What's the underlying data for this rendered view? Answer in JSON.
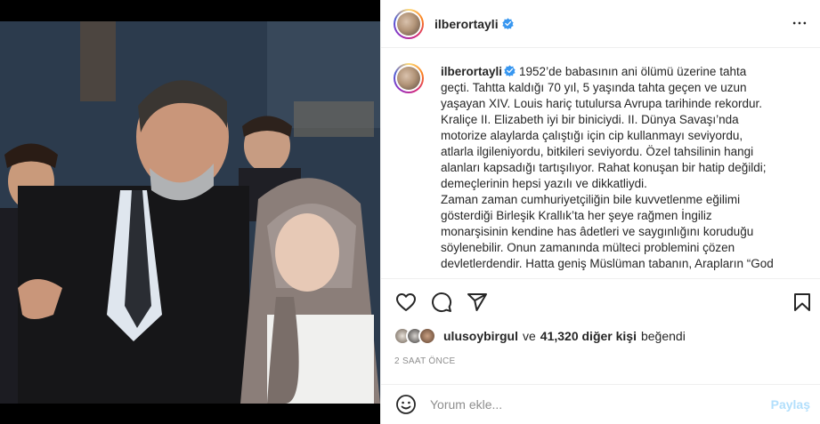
{
  "post": {
    "username": "ilberortayli",
    "caption_lines": [
      "1952’de babasının ani ölümü üzerine tahta",
      "geçti. Tahtta kaldığı 70 yıl, 5 yaşında tahta geçen ve uzun",
      "yaşayan XIV. Louis hariç tutulursa Avrupa tarihinde rekordur.",
      "Kraliçe II. Elizabeth iyi bir biniciydi. II. Dünya Savaşı’nda",
      "motorize alaylarda çalıştığı için cip kullanmayı seviyordu,",
      "atlarla ilgileniyordu, bitkileri seviyordu. Özel tahsilinin hangi",
      "alanları kapsadığı tartışılıyor. Rahat konuşan bir hatip değildi;",
      "demeçlerinin hepsi yazılı ve dikkatliydi.",
      "Zaman zaman cumhuriyetçiliğin bile kuvvetlenme eğilimi",
      "gösterdiği Birleşik Krallık’ta her şeye rağmen İngiliz",
      "monarşisinin kendine has âdetleri ve saygınlığını koruduğu",
      "söylenebilir. Onun zamanında mülteci problemini çözen",
      "devletlerdendir. Hatta geniş Müslüman tabanın, Arapların “God"
    ],
    "liked_by_user": "ulusoybirgul",
    "likes_connector": "ve",
    "likes_others": "41,320 diğer kişi",
    "likes_suffix": "beğendi",
    "timestamp": "2 SAAT ÖNCE"
  },
  "comment": {
    "placeholder": "Yorum ekle...",
    "post_label": "Paylaş"
  },
  "icons": {
    "verified": "verified-badge-icon",
    "more": "more-options-icon",
    "like": "heart-icon",
    "comment": "comment-icon",
    "share": "share-icon",
    "save": "bookmark-icon",
    "emoji": "emoji-icon"
  },
  "colors": {
    "verified_blue": "#3897f0",
    "post_button_disabled": "#b2dffc",
    "muted": "#8e8e8e",
    "text": "#262626"
  }
}
